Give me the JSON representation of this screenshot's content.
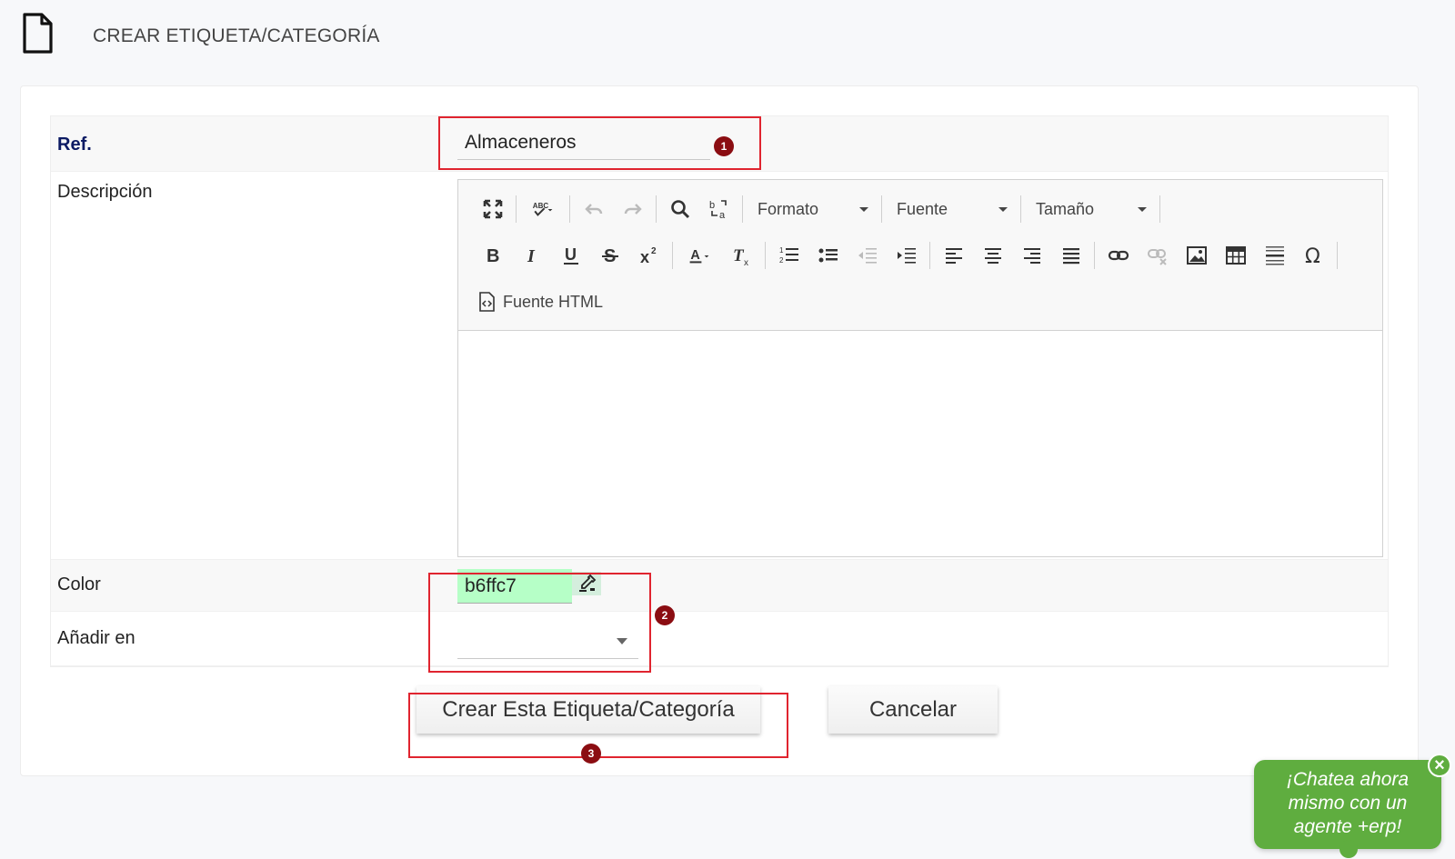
{
  "page": {
    "title": "CREAR ETIQUETA/CATEGORÍA",
    "icon": "document-icon"
  },
  "form": {
    "ref": {
      "label": "Ref.",
      "value": "Almaceneros"
    },
    "descripcion": {
      "label": "Descripción",
      "toolbar": {
        "row1": [
          "maximize-icon",
          "spellcheck-icon",
          "undo-icon",
          "redo-icon",
          "find-icon",
          "replace-icon"
        ],
        "formato_label": "Formato",
        "fuente_label": "Fuente",
        "tamano_label": "Tamaño",
        "row2": [
          "bold-icon",
          "italic-icon",
          "underline-icon",
          "strikethrough-icon",
          "superscript-icon",
          "text-color-icon",
          "remove-format-icon",
          "numbered-list-icon",
          "bulleted-list-icon",
          "decrease-indent-icon",
          "increase-indent-icon",
          "align-left-icon",
          "align-center-icon",
          "align-right-icon",
          "justify-icon",
          "link-icon",
          "unlink-icon",
          "image-icon",
          "table-icon",
          "horizontal-line-icon",
          "special-char-icon"
        ],
        "source_label": "Fuente HTML"
      },
      "content": ""
    },
    "color": {
      "label": "Color",
      "value": "b6ffc7",
      "swatch": "#b6ffc7"
    },
    "anadir": {
      "label": "Añadir en",
      "value": ""
    }
  },
  "buttons": {
    "create_label": "Crear Esta Etiqueta/Categoría",
    "cancel_label": "Cancelar"
  },
  "annotations": {
    "badge1": "1",
    "badge2": "2",
    "badge3": "3",
    "color": "#e0242f"
  },
  "chat": {
    "line1": "¡Chatea ahora",
    "line2": "mismo con un",
    "line3": "agente +erp!",
    "close": "×",
    "color": "#5fad3f"
  }
}
